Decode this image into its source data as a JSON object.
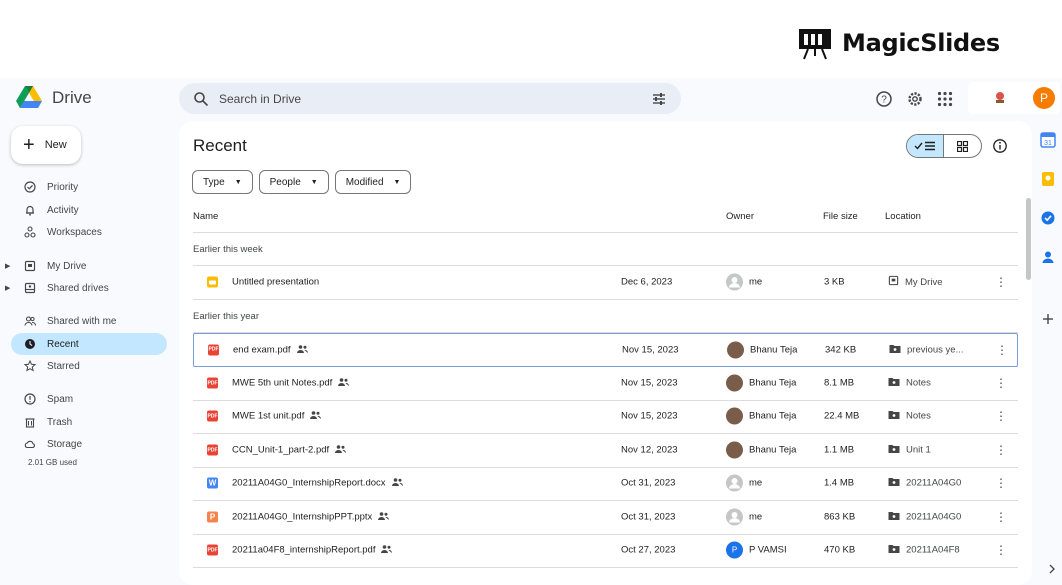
{
  "banner": {
    "brand": "MagicSlides"
  },
  "app": {
    "name": "Drive"
  },
  "search": {
    "placeholder": "Search in Drive"
  },
  "account": {
    "avatar_letter": "P"
  },
  "sidebar": {
    "new_label": "New",
    "items": [
      {
        "label": "Priority",
        "icon": "check-circle-icon"
      },
      {
        "label": "Activity",
        "icon": "bell-icon"
      },
      {
        "label": "Workspaces",
        "icon": "workspaces-icon"
      },
      {
        "label": "My Drive",
        "icon": "my-drive-icon"
      },
      {
        "label": "Shared drives",
        "icon": "shared-drives-icon"
      },
      {
        "label": "Shared with me",
        "icon": "people-icon"
      },
      {
        "label": "Recent",
        "icon": "clock-icon"
      },
      {
        "label": "Starred",
        "icon": "star-icon"
      },
      {
        "label": "Spam",
        "icon": "spam-icon"
      },
      {
        "label": "Trash",
        "icon": "trash-icon"
      },
      {
        "label": "Storage",
        "icon": "cloud-icon"
      }
    ],
    "storage_used": "2.01 GB used"
  },
  "main": {
    "title": "Recent",
    "filters": [
      "Type",
      "People",
      "Modified"
    ],
    "columns": {
      "name": "Name",
      "owner": "Owner",
      "size": "File size",
      "location": "Location"
    },
    "groups": [
      "Earlier this week",
      "Earlier this year"
    ],
    "files": [
      {
        "name": "Untitled presentation",
        "type": "slides",
        "shared": false,
        "date": "Dec 6, 2023",
        "owner": "me",
        "size": "3 KB",
        "location": "My Drive"
      },
      {
        "name": "end exam.pdf",
        "type": "pdf",
        "shared": true,
        "date": "Nov 15, 2023",
        "owner": "Bhanu Teja",
        "size": "342 KB",
        "location": "previous ye..."
      },
      {
        "name": "MWE 5th unit Notes.pdf",
        "type": "pdf",
        "shared": true,
        "date": "Nov 15, 2023",
        "owner": "Bhanu Teja",
        "size": "8.1 MB",
        "location": "Notes"
      },
      {
        "name": "MWE 1st unit.pdf",
        "type": "pdf",
        "shared": true,
        "date": "Nov 15, 2023",
        "owner": "Bhanu Teja",
        "size": "22.4 MB",
        "location": "Notes"
      },
      {
        "name": "CCN_Unit-1_part-2.pdf",
        "type": "pdf",
        "shared": true,
        "date": "Nov 12, 2023",
        "owner": "Bhanu Teja",
        "size": "1.1 MB",
        "location": "Unit 1"
      },
      {
        "name": "20211A04G0_InternshipReport.docx",
        "type": "docx",
        "shared": true,
        "date": "Oct 31, 2023",
        "owner": "me",
        "size": "1.4 MB",
        "location": "20211A04G0"
      },
      {
        "name": "20211A04G0_InternshipPPT.pptx",
        "type": "pptx",
        "shared": true,
        "date": "Oct 31, 2023",
        "owner": "me",
        "size": "863 KB",
        "location": "20211A04G0"
      },
      {
        "name": "20211a04F8_internshipReport.pdf",
        "type": "pdf",
        "shared": true,
        "date": "Oct 27, 2023",
        "owner": "P VAMSI",
        "owner_initial": "P",
        "size": "470 KB",
        "location": "20211A04F8"
      }
    ]
  },
  "colors": {
    "accent": "#c2e7ff",
    "pdf": "#ea4335",
    "docx": "#4285f4",
    "pptx": "#f4844c",
    "slides": "#fbbc04",
    "avatar": "#f57c00"
  }
}
